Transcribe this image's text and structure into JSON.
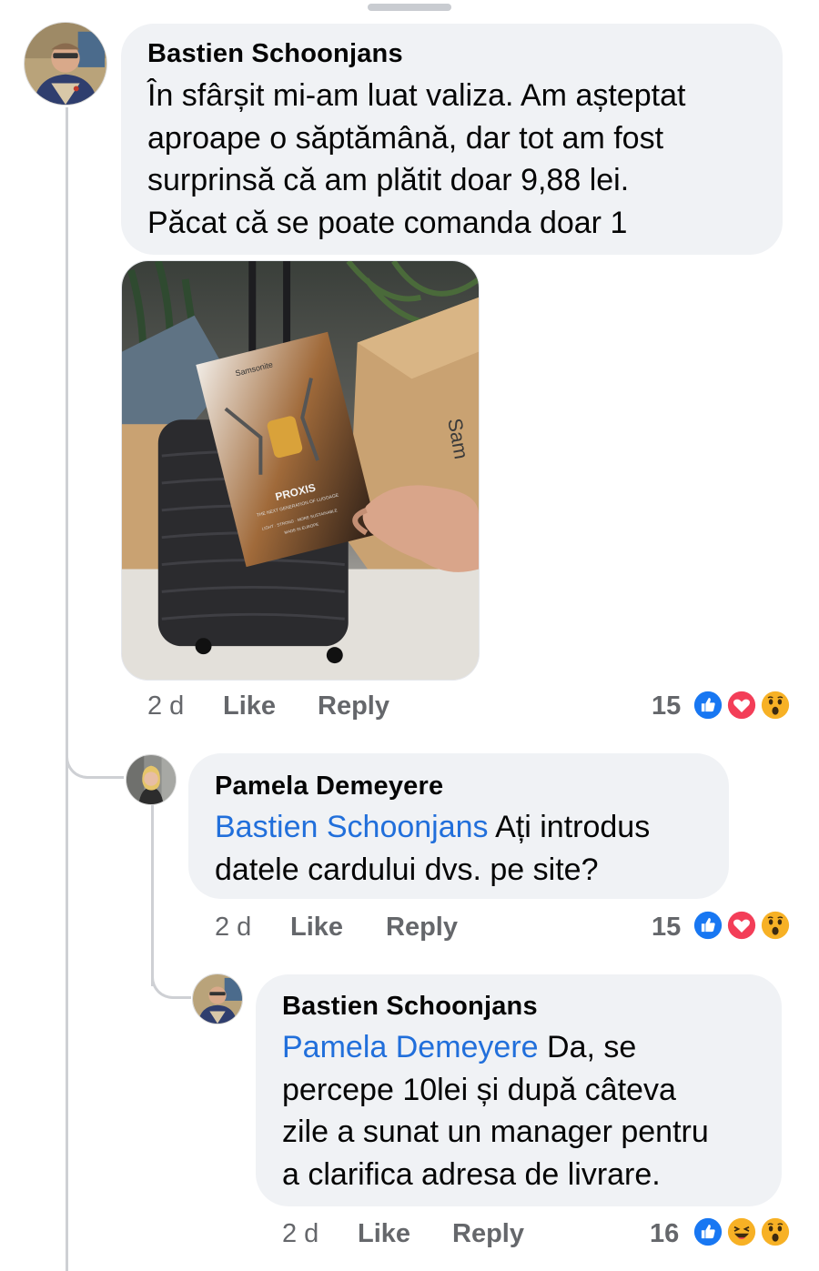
{
  "comments": [
    {
      "author": "Bastien Schoonjans",
      "lines": [
        "În sfârșit mi-am luat valiza. Am așteptat",
        "aproape o săptămână, dar tot am fost",
        "surprinsă că am plătit doar 9,88 lei.",
        "Păcat că se poate comanda doar 1"
      ],
      "time": "2 d",
      "like": "Like",
      "reply": "Reply",
      "reaction_count": "15",
      "reactions": [
        "like-reaction-icon",
        "love-reaction-icon",
        "wow-reaction-icon"
      ],
      "photo": {
        "brand": "Samsonite",
        "product": "PROXIS",
        "tagline": "THE NEXT GENERATION OF LUGGAGE",
        "features": "LIGHT · STRONG · MORE SUSTAINABLE",
        "made_in": "MADE IN EUROPE"
      }
    },
    {
      "author": "Pamela Demeyere",
      "mention": "Bastien Schoonjans",
      "line1_rest": " Ați introdus",
      "line2": "datele cardului dvs. pe site?",
      "time": "2 d",
      "like": "Like",
      "reply": "Reply",
      "reaction_count": "15",
      "reactions": [
        "like-reaction-icon",
        "love-reaction-icon",
        "wow-reaction-icon"
      ]
    },
    {
      "author": "Bastien Schoonjans",
      "mention": "Pamela Demeyere",
      "line1_rest": " Da, se",
      "lines_rest": [
        "percepe 10lei și după câteva",
        "zile a sunat un manager pentru",
        "a clarifica adresa de livrare."
      ],
      "time": "2 d",
      "like": "Like",
      "reply": "Reply",
      "reaction_count": "16",
      "reactions": [
        "like-reaction-icon",
        "haha-reaction-icon",
        "wow-reaction-icon"
      ]
    }
  ],
  "colors": {
    "bubble": "#f0f2f5",
    "mention": "#216fdb",
    "meta_text": "#65676b",
    "like_blue": "#1877f2",
    "love_red": "#f33e58",
    "emoji_yellow": "#f7b125"
  }
}
